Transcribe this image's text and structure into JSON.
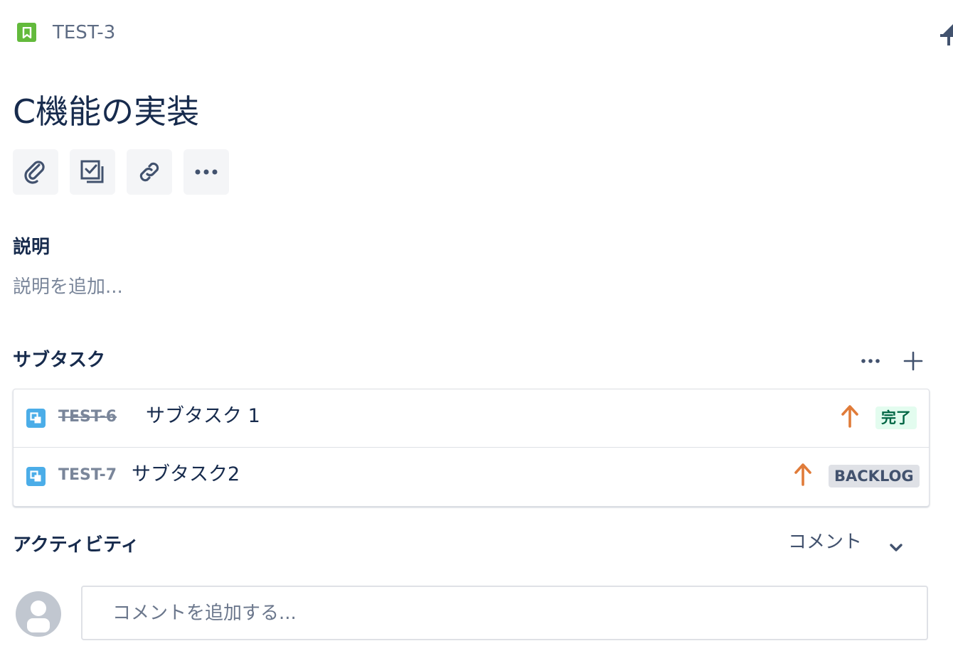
{
  "header": {
    "issue_key": "TEST-3",
    "issue_type_icon": "story-bookmark-icon",
    "issue_type_color": "#63ba3c"
  },
  "issue": {
    "title": "C機能の実装"
  },
  "toolbar": {
    "buttons": [
      {
        "icon": "paperclip-icon"
      },
      {
        "icon": "subtask-checkbox-icon"
      },
      {
        "icon": "link-icon"
      },
      {
        "icon": "more-horizontal-icon"
      }
    ]
  },
  "description": {
    "heading": "説明",
    "placeholder": "説明を追加..."
  },
  "subtasks": {
    "heading": "サブタスク",
    "items": [
      {
        "key": "TEST-6",
        "summary": "サブタスク 1",
        "priority_icon": "priority-high-arrow-icon",
        "status": "完了",
        "done": true
      },
      {
        "key": "TEST-7",
        "summary": "サブタスク2",
        "priority_icon": "priority-high-arrow-icon",
        "status": "BACKLOG",
        "done": false
      }
    ]
  },
  "activity": {
    "heading": "アクティビティ",
    "filter": "コメント",
    "comment_placeholder": "コメントを追加する..."
  },
  "colors": {
    "priority": "#e07b39",
    "subtask_icon": "#4bade8",
    "status_done_bg": "#e3fcef",
    "status_done_text": "#006644",
    "status_backlog_bg": "#dfe1e6",
    "status_backlog_text": "#42526e"
  }
}
